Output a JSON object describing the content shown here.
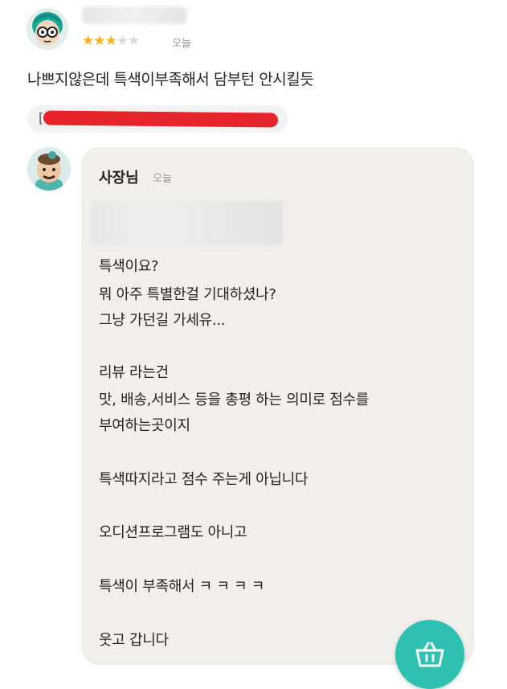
{
  "review": {
    "rating": 3,
    "max_rating": 5,
    "time": "오늘",
    "text": "나쁘지않은데 특색이부족해서 담부턴 안시킬듯",
    "menu_chip_bracket": "["
  },
  "reply": {
    "name": "사장님",
    "time": "오늘",
    "lines": [
      "특색이요?",
      "뭐  아주 특별한걸 기대하셨나?",
      "그냥 가던길 가세유...",
      "리뷰 라는건",
      "맛, 배송,서비스  등을  총평 하는 의미로  점수를",
      "부여하는곳이지",
      "특색따지라고 점수 주는게 아닙니다",
      "오디션프로그램도 아니고",
      "특색이 부족해서  ㅋ ㅋ ㅋ ㅋ",
      "웃고 갑니다"
    ]
  },
  "icons": {
    "stars": "star-icon",
    "cart": "shopping-basket-icon"
  },
  "colors": {
    "star_filled": "#f6b41a",
    "star_empty": "#d9d9d9",
    "reply_background": "#f1efeb",
    "cart_button": "#2ec1b2",
    "redaction": "#e4232b"
  }
}
